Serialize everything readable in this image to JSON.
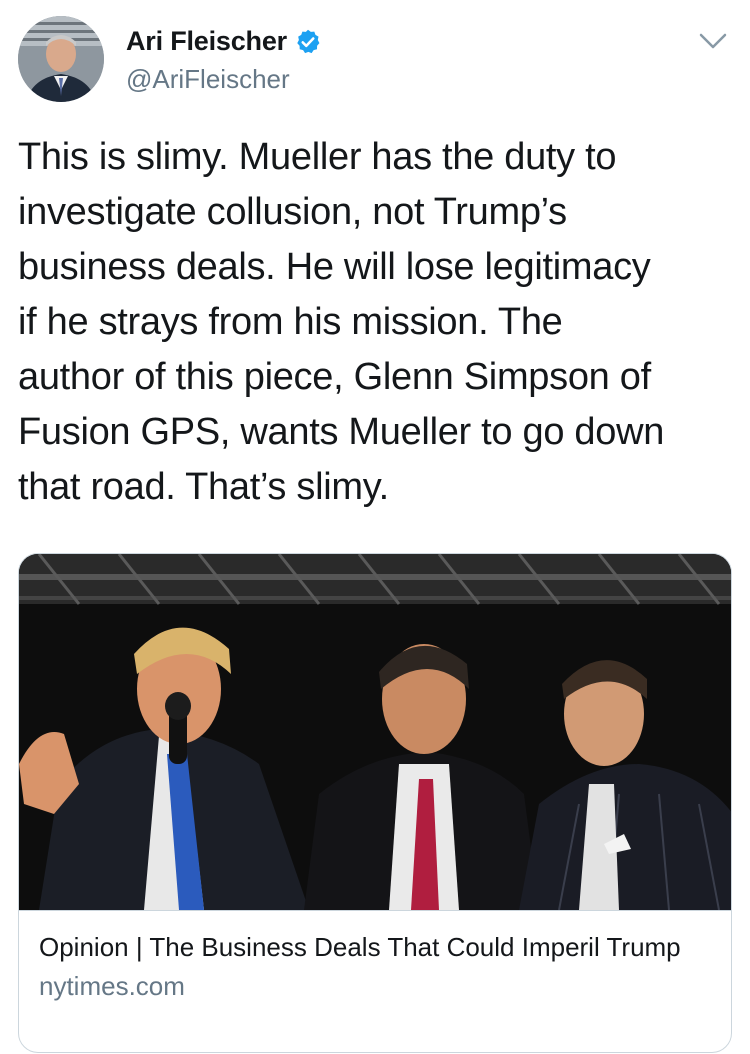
{
  "author": {
    "display_name": "Ari Fleischer",
    "handle": "@AriFleischer",
    "verified": true,
    "avatar_icon": "profile-photo",
    "verified_icon": "verified-badge-icon",
    "more_icon": "chevron-down-icon"
  },
  "tweet": {
    "text": "This is slimy.  Mueller has the duty to\ninvestigate collusion, not Trump’s\nbusiness deals.  He will lose legitimacy\nif he strays from his mission. The\nauthor of this piece, Glenn Simpson of\nFusion GPS, wants Mueller to go down\nthat road. That’s slimy."
  },
  "link_card": {
    "title": "Opinion | The Business Deals That Could Imperil Trump",
    "domain": "nytimes.com"
  },
  "colors": {
    "verified_blue": "#1da1f2",
    "secondary_text": "#657786",
    "card_border": "#ccd6dd"
  }
}
